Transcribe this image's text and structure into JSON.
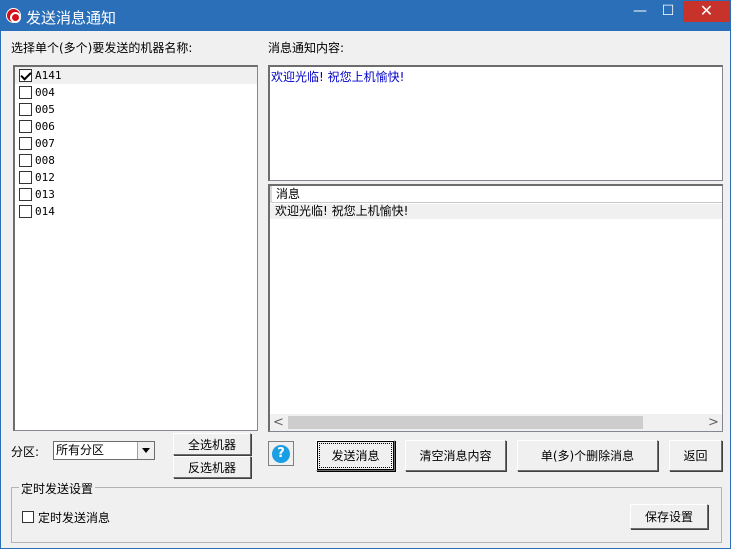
{
  "window": {
    "title": "发送消息通知",
    "minimize": "—",
    "maximize": "☐",
    "close": "✕"
  },
  "machines": {
    "label": "选择单个(多个)要发送的机器名称:",
    "items": [
      {
        "name": "A141",
        "checked": true
      },
      {
        "name": "004",
        "checked": false
      },
      {
        "name": "005",
        "checked": false
      },
      {
        "name": "006",
        "checked": false
      },
      {
        "name": "007",
        "checked": false
      },
      {
        "name": "008",
        "checked": false
      },
      {
        "name": "012",
        "checked": false
      },
      {
        "name": "013",
        "checked": false
      },
      {
        "name": "014",
        "checked": false
      }
    ]
  },
  "message": {
    "label": "消息通知内容:",
    "content": "欢迎光临! 祝您上机愉快!"
  },
  "message_list": {
    "column_header": "消息",
    "rows": [
      "欢迎光临! 祝您上机愉快!"
    ],
    "scroll_left": "<",
    "scroll_right": ">"
  },
  "zone": {
    "label": "分区:",
    "selected": "所有分区"
  },
  "buttons": {
    "select_all": "全选机器",
    "invert_select": "反选机器",
    "help": "?",
    "send": "发送消息",
    "clear": "清空消息内容",
    "delete": "单(多)个删除消息",
    "back": "返回",
    "save_settings": "保存设置"
  },
  "timer": {
    "group_title": "定时发送设置",
    "checkbox_label": "定时发送消息"
  },
  "colors": {
    "titlebar": "#2b6fb8",
    "close_button": "#c7322b",
    "message_text": "#0000c8",
    "help_icon": "#1a9ee4"
  }
}
